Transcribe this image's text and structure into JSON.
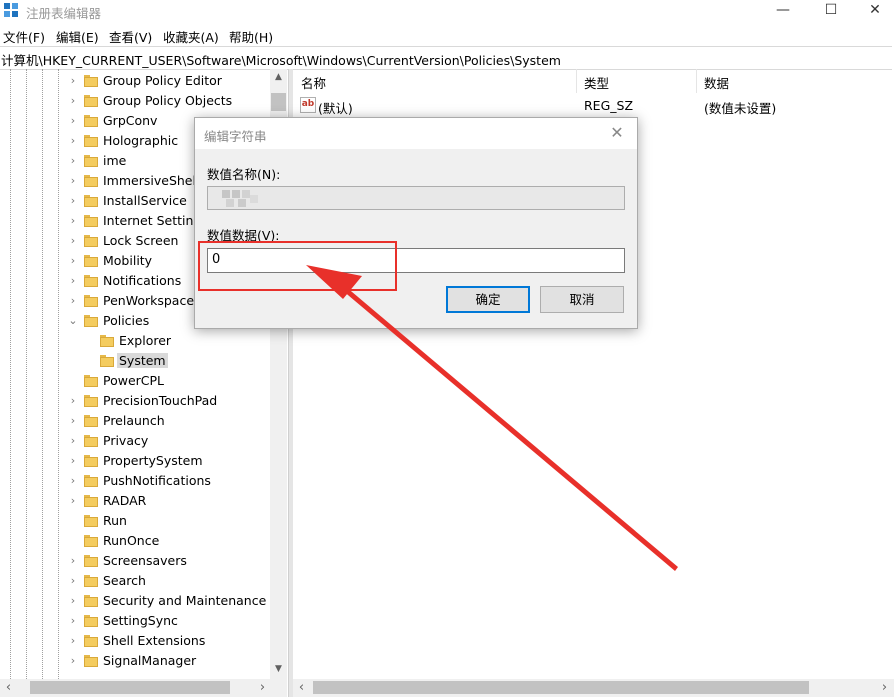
{
  "window": {
    "title": "注册表编辑器",
    "icon": "regedit-icon",
    "controls": [
      "—",
      "☐",
      "✕"
    ]
  },
  "menu": [
    "文件(F)",
    "编辑(E)",
    "查看(V)",
    "收藏夹(A)",
    "帮助(H)"
  ],
  "address": "计算机\\HKEY_CURRENT_USER\\Software\\Microsoft\\Windows\\CurrentVersion\\Policies\\System",
  "tree": {
    "items": [
      {
        "label": "Group Policy Editor",
        "level": 0,
        "expander": "›"
      },
      {
        "label": "Group Policy Objects",
        "level": 0,
        "expander": "›"
      },
      {
        "label": "GrpConv",
        "level": 0,
        "expander": "›"
      },
      {
        "label": "Holographic",
        "level": 0,
        "expander": "›"
      },
      {
        "label": "ime",
        "level": 0,
        "expander": "›"
      },
      {
        "label": "ImmersiveShell",
        "level": 0,
        "expander": "›"
      },
      {
        "label": "InstallService",
        "level": 0,
        "expander": "›"
      },
      {
        "label": "Internet Settings",
        "level": 0,
        "expander": "›"
      },
      {
        "label": "Lock Screen",
        "level": 0,
        "expander": "›"
      },
      {
        "label": "Mobility",
        "level": 0,
        "expander": "›"
      },
      {
        "label": "Notifications",
        "level": 0,
        "expander": "›"
      },
      {
        "label": "PenWorkspace",
        "level": 0,
        "expander": "›"
      },
      {
        "label": "Policies",
        "level": 0,
        "expander": "⌄"
      },
      {
        "label": "Explorer",
        "level": 1,
        "expander": ""
      },
      {
        "label": "System",
        "level": 1,
        "expander": "",
        "selected": true
      },
      {
        "label": "PowerCPL",
        "level": 0,
        "expander": ""
      },
      {
        "label": "PrecisionTouchPad",
        "level": 0,
        "expander": "›"
      },
      {
        "label": "Prelaunch",
        "level": 0,
        "expander": "›"
      },
      {
        "label": "Privacy",
        "level": 0,
        "expander": "›"
      },
      {
        "label": "PropertySystem",
        "level": 0,
        "expander": "›"
      },
      {
        "label": "PushNotifications",
        "level": 0,
        "expander": "›"
      },
      {
        "label": "RADAR",
        "level": 0,
        "expander": "›"
      },
      {
        "label": "Run",
        "level": 0,
        "expander": ""
      },
      {
        "label": "RunOnce",
        "level": 0,
        "expander": ""
      },
      {
        "label": "Screensavers",
        "level": 0,
        "expander": "›"
      },
      {
        "label": "Search",
        "level": 0,
        "expander": "›"
      },
      {
        "label": "Security and Maintenance",
        "level": 0,
        "expander": "›"
      },
      {
        "label": "SettingSync",
        "level": 0,
        "expander": "›"
      },
      {
        "label": "Shell Extensions",
        "level": 0,
        "expander": "›"
      },
      {
        "label": "SignalManager",
        "level": 0,
        "expander": "›"
      }
    ]
  },
  "list": {
    "headers": {
      "name": "名称",
      "type": "类型",
      "data": "数据"
    },
    "rows": [
      {
        "name": "(默认)",
        "type": "REG_SZ",
        "data": "(数值未设置)",
        "icon": "string-value-icon"
      }
    ]
  },
  "dialog": {
    "title": "编辑字符串",
    "name_label": "数值名称(N):",
    "data_label": "数值数据(V):",
    "data_value": "0",
    "ok_label": "确定",
    "cancel_label": "取消",
    "close_glyph": "✕"
  },
  "annotation": {
    "color": "#e8302a"
  },
  "scroll_glyphs": {
    "up": "▲",
    "down": "▼",
    "left": "‹",
    "right": "›"
  }
}
